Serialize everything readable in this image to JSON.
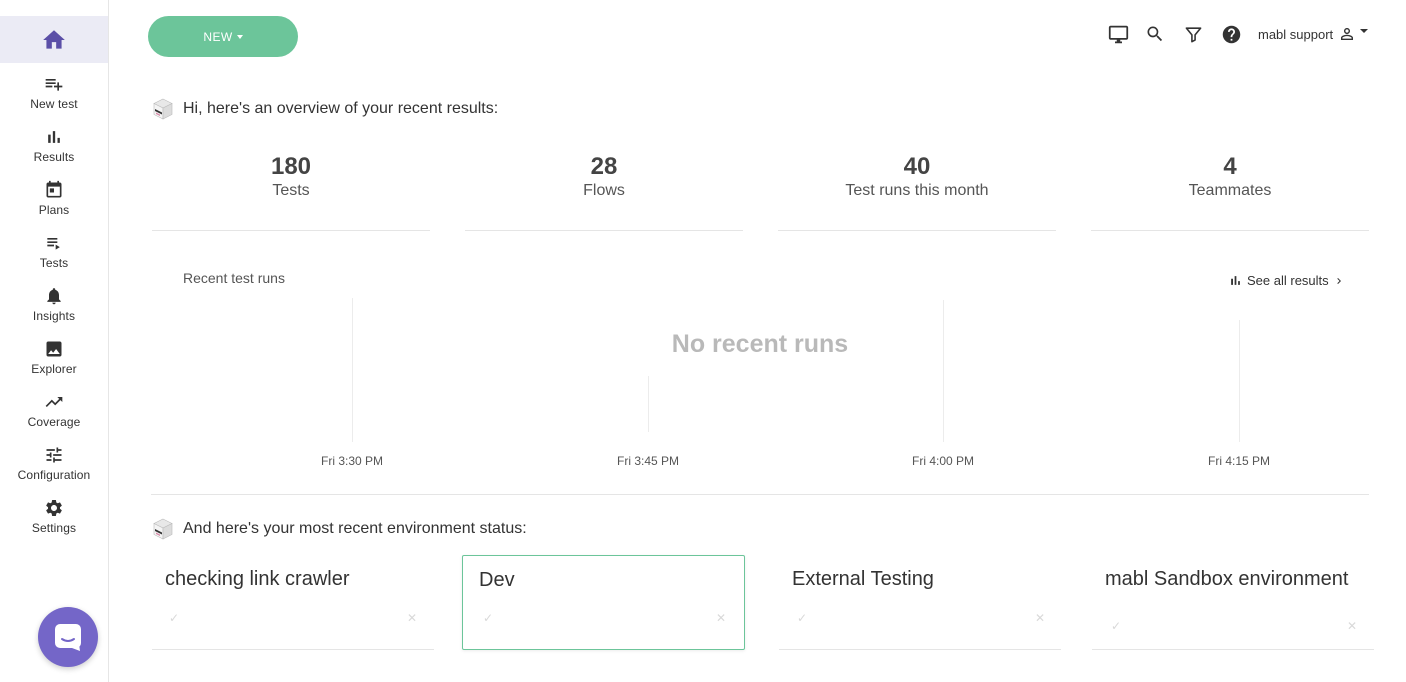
{
  "sidebar": {
    "home_icon": "home-icon",
    "items": [
      {
        "label": "New test",
        "icon": "playlist-add-icon"
      },
      {
        "label": "Results",
        "icon": "bar-chart-icon"
      },
      {
        "label": "Plans",
        "icon": "calendar-icon"
      },
      {
        "label": "Tests",
        "icon": "playlist-play-icon"
      },
      {
        "label": "Insights",
        "icon": "bell-icon"
      },
      {
        "label": "Explorer",
        "icon": "image-icon"
      },
      {
        "label": "Coverage",
        "icon": "trending-up-icon"
      },
      {
        "label": "Configuration",
        "icon": "sliders-icon"
      },
      {
        "label": "Settings",
        "icon": "gear-icon"
      }
    ],
    "chat_icon": "chat-icon"
  },
  "header": {
    "new_button_label": "NEW",
    "icons": [
      "monitor-icon",
      "search-icon",
      "filter-icon",
      "help-icon"
    ],
    "user_name": "mabl support"
  },
  "overview": {
    "heading": "Hi, here's an overview of your recent results:",
    "stats": [
      {
        "value": "180",
        "label": "Tests"
      },
      {
        "value": "28",
        "label": "Flows"
      },
      {
        "value": "40",
        "label": "Test runs this month"
      },
      {
        "value": "4",
        "label": "Teammates"
      }
    ]
  },
  "chart_data": {
    "type": "bar",
    "title": "Recent test runs",
    "categories": [
      "Fri 3:30 PM",
      "Fri 3:45 PM",
      "Fri 4:00 PM",
      "Fri 4:15 PM"
    ],
    "series": [],
    "empty_message": "No recent runs",
    "grid": true
  },
  "see_all_label": "See all results",
  "environments": {
    "heading": "And here's your most recent environment status:",
    "cards": [
      {
        "name": "checking link crawler",
        "selected": false
      },
      {
        "name": "Dev",
        "selected": true
      },
      {
        "name": "External Testing",
        "selected": false
      },
      {
        "name": "mabl Sandbox environment",
        "selected": false
      }
    ],
    "pass_glyph": "✓",
    "fail_glyph": "✕"
  },
  "colors": {
    "accent_purple": "#5b4fa7",
    "home_bg": "#ebebf5",
    "new_button": "#6cc59a",
    "chat_bubble": "#7466c8"
  }
}
